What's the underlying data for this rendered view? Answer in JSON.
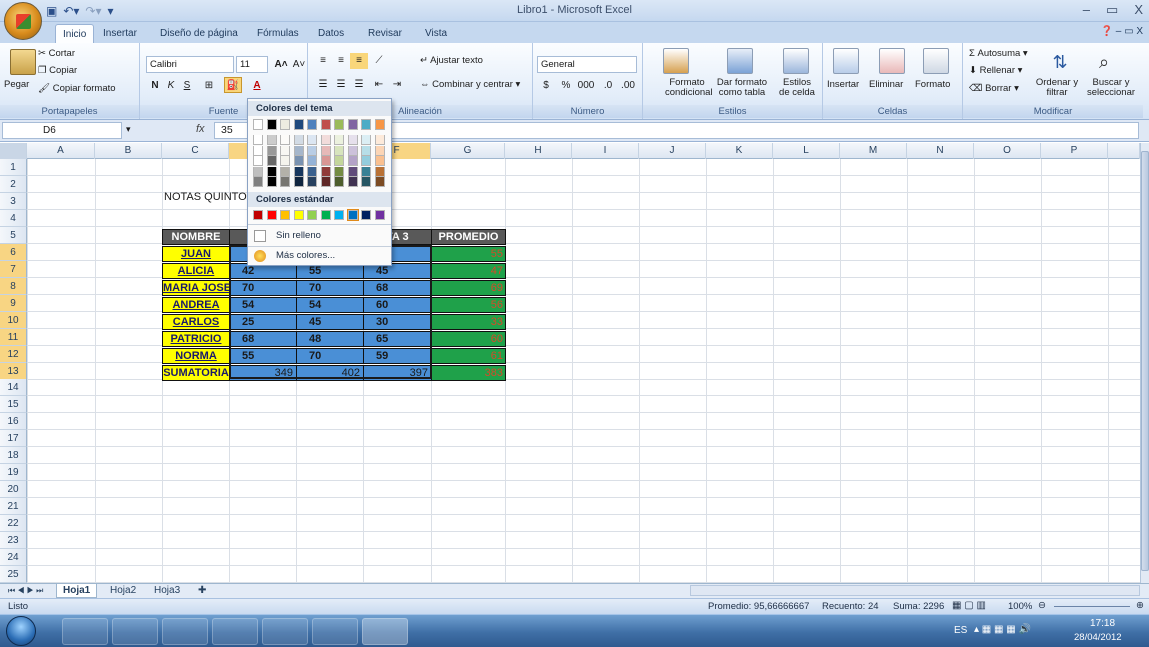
{
  "window": {
    "title": "Libro1 - Microsoft Excel",
    "controls": [
      "–",
      "▭",
      "X"
    ]
  },
  "tabs": [
    "Inicio",
    "Insertar",
    "Diseño de página",
    "Fórmulas",
    "Datos",
    "Revisar",
    "Vista"
  ],
  "active_tab": "Inicio",
  "ribbon": {
    "portapapeles": {
      "label": "Portapapeles",
      "pegar": "Pegar",
      "cortar": "Cortar",
      "copiar": "Copiar",
      "copiar_formato": "Copiar formato"
    },
    "fuente": {
      "label": "Fuente",
      "font": "Calibri",
      "size": "11"
    },
    "alineacion": {
      "label": "Alineación",
      "ajustar": "Ajustar texto",
      "combinar": "Combinar y centrar"
    },
    "numero": {
      "label": "Número",
      "format": "General"
    },
    "estilos": {
      "label": "Estilos",
      "formato_cond": "Formato condicional",
      "dar_formato": "Dar formato como tabla",
      "estilos_celda": "Estilos de celda"
    },
    "celdas": {
      "label": "Celdas",
      "insertar": "Insertar",
      "eliminar": "Eliminar",
      "formato": "Formato"
    },
    "modificar": {
      "label": "Modificar",
      "autosuma": "Autosuma",
      "rellenar": "Rellenar",
      "borrar": "Borrar",
      "ordenar": "Ordenar y filtrar",
      "buscar": "Buscar y seleccionar"
    }
  },
  "formula_bar": {
    "name_box": "D6",
    "formula": "35"
  },
  "columns": [
    "A",
    "B",
    "C",
    "D",
    "E",
    "F",
    "G",
    "H",
    "I",
    "J",
    "K",
    "L",
    "M",
    "N",
    "O",
    "P"
  ],
  "rows": [
    "1",
    "2",
    "3",
    "4",
    "5",
    "6",
    "7",
    "8",
    "9",
    "10",
    "11",
    "12",
    "13",
    "14",
    "15",
    "16",
    "17",
    "18",
    "19",
    "20",
    "21",
    "22",
    "23",
    "24",
    "25"
  ],
  "sheet": {
    "title": "NOTAS QUINTO",
    "header": [
      "NOMBRE",
      "",
      "",
      "TA 3",
      "PROMEDIO"
    ],
    "students": [
      {
        "name": "JUAN",
        "n1": "",
        "n2": "",
        "n3": "70",
        "avg": "55"
      },
      {
        "name": "ALICIA",
        "n1": "42",
        "n2": "55",
        "n3": "45",
        "avg": "47"
      },
      {
        "name": "MARIA JOSE",
        "n1": "70",
        "n2": "70",
        "n3": "68",
        "avg": "69"
      },
      {
        "name": "ANDREA",
        "n1": "54",
        "n2": "54",
        "n3": "60",
        "avg": "56"
      },
      {
        "name": "CARLOS",
        "n1": "25",
        "n2": "45",
        "n3": "30",
        "avg": "33"
      },
      {
        "name": "PATRICIO",
        "n1": "68",
        "n2": "48",
        "n3": "65",
        "avg": "60"
      },
      {
        "name": "NORMA",
        "n1": "55",
        "n2": "70",
        "n3": "59",
        "avg": "61"
      }
    ],
    "total": {
      "name": "SUMATORIA",
      "n1": "349",
      "n2": "402",
      "n3": "397",
      "avg": "383"
    }
  },
  "fill_dropdown": {
    "theme_header": "Colores del tema",
    "standard_header": "Colores estándar",
    "no_fill": "Sin relleno",
    "more": "Más colores...",
    "theme_colors": [
      "#ffffff",
      "#000000",
      "#eeece1",
      "#1f497d",
      "#4f81bd",
      "#c0504d",
      "#9bbb59",
      "#8064a2",
      "#4bacc6",
      "#f79646"
    ],
    "standard_colors": [
      "#c00000",
      "#ff0000",
      "#ffc000",
      "#ffff00",
      "#92d050",
      "#00b050",
      "#00b0f0",
      "#0070c0",
      "#002060",
      "#7030a0"
    ]
  },
  "sheets": [
    "Hoja1",
    "Hoja2",
    "Hoja3"
  ],
  "status": {
    "ready": "Listo",
    "promedio": "Promedio: 95,66666667",
    "recuento": "Recuento: 24",
    "suma": "Suma: 2296",
    "zoom": "100%"
  },
  "taskbar": {
    "lang": "ES",
    "time": "17:18",
    "date": "28/04/2012"
  }
}
